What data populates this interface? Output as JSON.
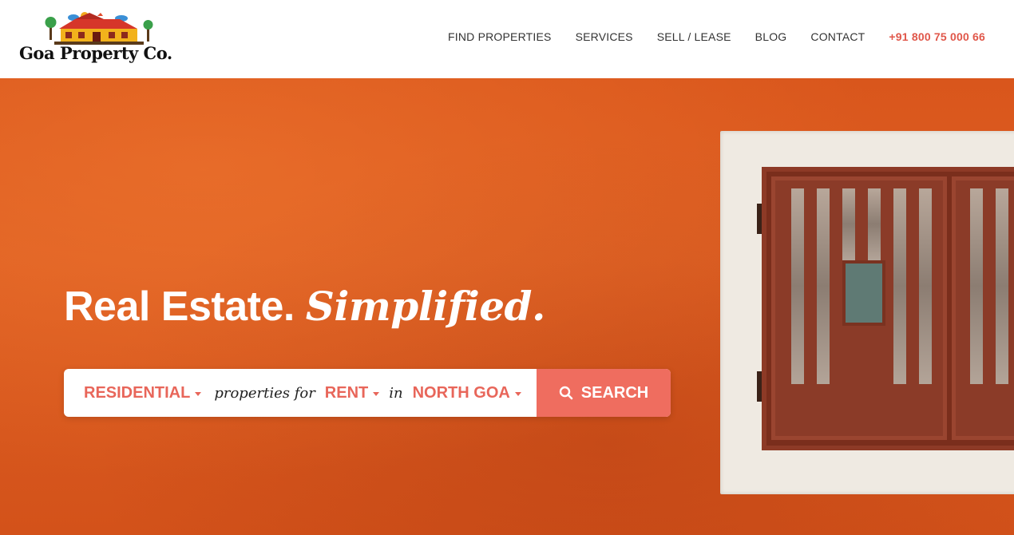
{
  "brand": {
    "name": "Goa Property Co.",
    "logo_icon": "house-logo-icon"
  },
  "nav": {
    "items": [
      {
        "label": "FIND PROPERTIES"
      },
      {
        "label": "SERVICES"
      },
      {
        "label": "SELL / LEASE"
      },
      {
        "label": "BLOG"
      },
      {
        "label": "CONTACT"
      }
    ],
    "phone": "+91 800 75 000 66"
  },
  "hero": {
    "title_main": "Real Estate.",
    "title_sub": "Simplified."
  },
  "search": {
    "type_value": "RESIDENTIAL",
    "connector_1": "properties for",
    "purpose_value": "RENT",
    "connector_2": "in",
    "location_value": "NORTH GOA",
    "button_label": "SEARCH",
    "button_icon": "search-icon"
  },
  "colors": {
    "accent": "#ef6d5f",
    "accent_text": "#e8665a",
    "hero_bg": "#d9561c"
  }
}
